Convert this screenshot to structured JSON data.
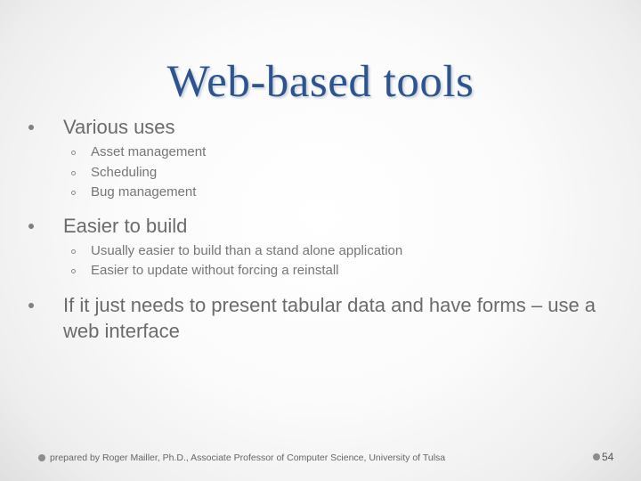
{
  "slide": {
    "title": "Web-based tools",
    "bullets": [
      {
        "text": "Various uses",
        "sub": [
          "Asset management",
          "Scheduling",
          "Bug management"
        ]
      },
      {
        "text": "Easier to build",
        "sub": [
          "Usually easier to build than a stand alone application",
          "Easier to update without forcing a reinstall"
        ]
      },
      {
        "text": "If it just needs to present tabular data and have forms – use a web interface",
        "sub": []
      }
    ],
    "footer": "prepared by Roger Mailler, Ph.D., Associate Professor of Computer Science, University of Tulsa",
    "page_number": "54"
  },
  "colors": {
    "title": "#2e5490",
    "body_text": "#6b6b6b",
    "sub_text": "#767676"
  }
}
